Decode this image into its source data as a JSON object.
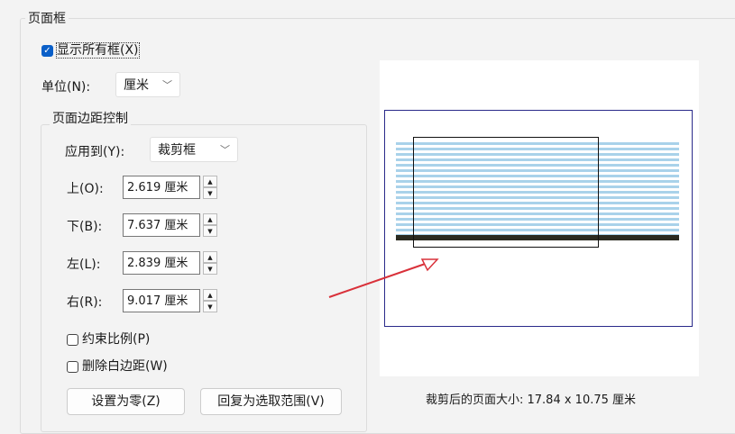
{
  "page_frame": {
    "title": "页面框",
    "show_all_label": "显示所有框(X)",
    "show_all_checked": true,
    "unit_label": "单位(N):",
    "unit_value": "厘米"
  },
  "margins": {
    "title": "页面边距控制",
    "apply_label": "应用到(Y):",
    "apply_value": "裁剪框",
    "fields": [
      {
        "label": "上(O):",
        "value": "2.619 厘米"
      },
      {
        "label": "下(B):",
        "value": "7.637 厘米"
      },
      {
        "label": "左(L):",
        "value": "2.839 厘米"
      },
      {
        "label": "右(R):",
        "value": "9.017 厘米"
      }
    ],
    "constrain_label": "约束比例(P)",
    "constrain_checked": false,
    "remove_white_label": "删除白边距(W)",
    "remove_white_checked": false,
    "zero_button": "设置为零(Z)",
    "revert_button": "回复为选取范围(V)"
  },
  "preview": {
    "size_label": "裁剪后的页面大小: 17.84 x 10.75 厘米"
  },
  "colors": {
    "accent": "#0a5fc8",
    "media_box": "#2a2a8a",
    "arrow": "#d9313a"
  }
}
